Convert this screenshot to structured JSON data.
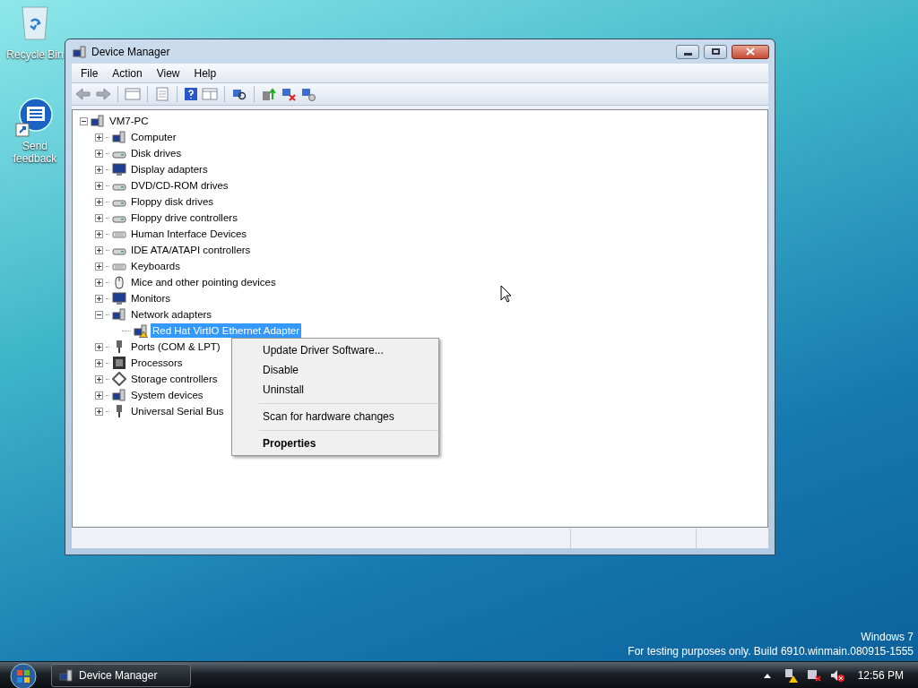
{
  "desktop_icons": [
    {
      "label": "Recycle Bin"
    },
    {
      "label": "Send feedback"
    }
  ],
  "window": {
    "title": "Device Manager",
    "menu": [
      "File",
      "Action",
      "View",
      "Help"
    ]
  },
  "tree": {
    "label": "VM7-PC",
    "expanded": true,
    "selected": false,
    "children": [
      {
        "label": "Computer",
        "expanded": false,
        "selected": false
      },
      {
        "label": "Disk drives",
        "expanded": false,
        "selected": false
      },
      {
        "label": "Display adapters",
        "expanded": false,
        "selected": false
      },
      {
        "label": "DVD/CD-ROM drives",
        "expanded": false,
        "selected": false
      },
      {
        "label": "Floppy disk drives",
        "expanded": false,
        "selected": false
      },
      {
        "label": "Floppy drive controllers",
        "expanded": false,
        "selected": false
      },
      {
        "label": "Human Interface Devices",
        "expanded": false,
        "selected": false
      },
      {
        "label": "IDE ATA/ATAPI controllers",
        "expanded": false,
        "selected": false
      },
      {
        "label": "Keyboards",
        "expanded": false,
        "selected": false
      },
      {
        "label": "Mice and other pointing devices",
        "expanded": false,
        "selected": false
      },
      {
        "label": "Monitors",
        "expanded": false,
        "selected": false
      },
      {
        "label": "Network adapters",
        "expanded": true,
        "selected": false,
        "children": [
          {
            "label": "Red Hat VirtIO Ethernet Adapter",
            "selected": true,
            "warning": true
          }
        ]
      },
      {
        "label": "Ports (COM & LPT)",
        "expanded": false,
        "selected": false
      },
      {
        "label": "Processors",
        "expanded": false,
        "selected": false
      },
      {
        "label": "Storage controllers",
        "expanded": false,
        "selected": false
      },
      {
        "label": "System devices",
        "expanded": false,
        "selected": false
      },
      {
        "label": "Universal Serial Bus",
        "expanded": false,
        "selected": false
      }
    ]
  },
  "context_menu": [
    {
      "kind": "item",
      "label": "Update Driver Software...",
      "default": false
    },
    {
      "kind": "item",
      "label": "Disable",
      "default": false
    },
    {
      "kind": "item",
      "label": "Uninstall",
      "default": false
    },
    {
      "kind": "separator"
    },
    {
      "kind": "item",
      "label": "Scan for hardware changes",
      "default": false
    },
    {
      "kind": "separator"
    },
    {
      "kind": "item",
      "label": "Properties",
      "default": true
    }
  ],
  "watermark": {
    "product": "Windows 7",
    "build": "For testing purposes only. Build 6910.winmain.080915-1555"
  },
  "taskbar": {
    "button": "Device Manager",
    "time": "12:56 PM"
  }
}
